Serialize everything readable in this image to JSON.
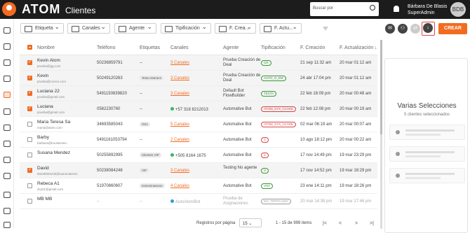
{
  "app": {
    "logo_text": "ATOM",
    "page_title": "Clientes"
  },
  "header": {
    "search_placeholder": "Buscar por",
    "user_name": "Bárbara De Blasis",
    "user_role": "SuperAdmin",
    "avatar_initials": "BDB"
  },
  "filters": [
    "Etiqueta",
    "Canales",
    "Agente",
    "Tipificación",
    "F. Crea...",
    "F. Actu..."
  ],
  "actions": {
    "create_label": "CREAR"
  },
  "columns": [
    "Nombre",
    "Teléfono",
    "Etiquetas",
    "Canales",
    "Agente",
    "Tipificación",
    "F. Creación",
    "F. Actualización"
  ],
  "sort_indicator": "↓",
  "rows": [
    {
      "name": "Kevin Atom",
      "email": "prueba@gg.com",
      "phone": "50236859791",
      "tag": "--",
      "channel": "3 Canales",
      "agent": "Prueba Creación de Deal",
      "tip": "CR",
      "tip_color": "#3a9a3a",
      "created": "21 sep 11:32 am",
      "updated": "20 mar 01:12 am",
      "checked": true
    },
    {
      "name": "Kevin",
      "email": "prueba@correo.com",
      "phone": "50249120263",
      "tag": "Testo interacti",
      "channel": "3 Canales",
      "agent": "Prueba Creación de Deal",
      "tip": "AUTO_O_EM",
      "tip_color": "#3a9a3a",
      "created": "24 abr 17:04 pm",
      "updated": "20 mar 01:12 am",
      "checked": true
    },
    {
      "name": "Luciana 22",
      "email": "prueba@gmail.com",
      "phone": "5491150839820",
      "tag": "--",
      "channel": "3 Canales",
      "agent": "Default Bot FlowBuilder",
      "tip": "TESTA",
      "tip_color": "#3a9a3a",
      "created": "22 feb 18:09 pm",
      "updated": "20 mar 00:48 am",
      "checked": true
    },
    {
      "name": "Luciana",
      "email": "prueba@gmail.com",
      "phone": "0582230760",
      "tag": "--",
      "channel": "+57 318 8212013",
      "channel_icon": "wa",
      "agent": "Automative Bot",
      "tip": "ATOM_SYS_CLOSE",
      "tip_color": "#d64545",
      "created": "22 feb 12:08 pm",
      "updated": "20 mar 00:19 am",
      "checked": true
    },
    {
      "name": "Maria Teresa Sa",
      "email": "maria@atom.com",
      "phone": "34693585043",
      "tag": "Otro",
      "channel": "5 Canales",
      "agent": "Automative Bot",
      "tip": "ATOM_SYS_CLOSE",
      "tip_color": "#d64545",
      "created": "02 mar 06:19 am",
      "updated": "20 mar 00:07 am",
      "checked": false
    },
    {
      "name": "Barby",
      "email": "barbara@bootsieves..",
      "phone": "5491161053794",
      "tag": "--",
      "channel": "2 Canales",
      "agent": "Automative Bot",
      "tip": "C",
      "tip_color": "#d64545",
      "created": "10 ago 18:12 pm",
      "updated": "20 mar 00:22 am",
      "checked": false
    },
    {
      "name": "Susana Mendez",
      "email": "",
      "phone": "50255892995",
      "tag": "Clientes VIP",
      "channel": "+505 8164 1675",
      "channel_icon": "wa",
      "agent": "Automative Bot",
      "tip": "C",
      "tip_color": "#d64545",
      "created": "17 nov 14:49 pm",
      "updated": "19 mar 23:29 pm",
      "checked": false
    },
    {
      "name": "David",
      "email": "50238084248@automatized..",
      "phone": "50238084248",
      "tag": "VIP",
      "channel": "3 Canales",
      "agent": "Testing No agente",
      "tip": "V",
      "tip_color": "#3a9a3a",
      "created": "17 nov 14:52 pm",
      "updated": "19 mar 18:29 pm",
      "checked": true
    },
    {
      "name": "Rebeca A1",
      "email": "dcy01@gmail.com",
      "phone": "51970860607",
      "tag": "enviosmasivos",
      "channel": "4 Canales",
      "agent": "Automative Bot",
      "tip": "VNT",
      "tip_color": "#3a9a3a",
      "created": "23 ene 14:11 pm",
      "updated": "19 mar 18:26 pm",
      "checked": false
    },
    {
      "name": "MB MB",
      "email": "",
      "phone": "--",
      "tag": "--",
      "channel": "AutoAtomBot",
      "channel_icon": "tg",
      "agent": "Prueba de Asignaciones",
      "tip": "NO_TIPIFICADO",
      "tip_color": "#999999",
      "created": "20 mar 14:38 pm",
      "updated": "19 mar 17:46 pm",
      "checked": false,
      "faded": true
    }
  ],
  "footer": {
    "rows_per_page_label": "Registros por página",
    "rows_per_page_value": "15",
    "range": "1 - 15 de 999 items",
    "nav": [
      "|<",
      "<",
      ">",
      ">|"
    ]
  },
  "side_panel": {
    "title": "Varias Selecciones",
    "subtitle": "5 clientes seleccionados"
  },
  "colors": {
    "accent": "#f26b21",
    "topbar": "#1c1c1c"
  }
}
